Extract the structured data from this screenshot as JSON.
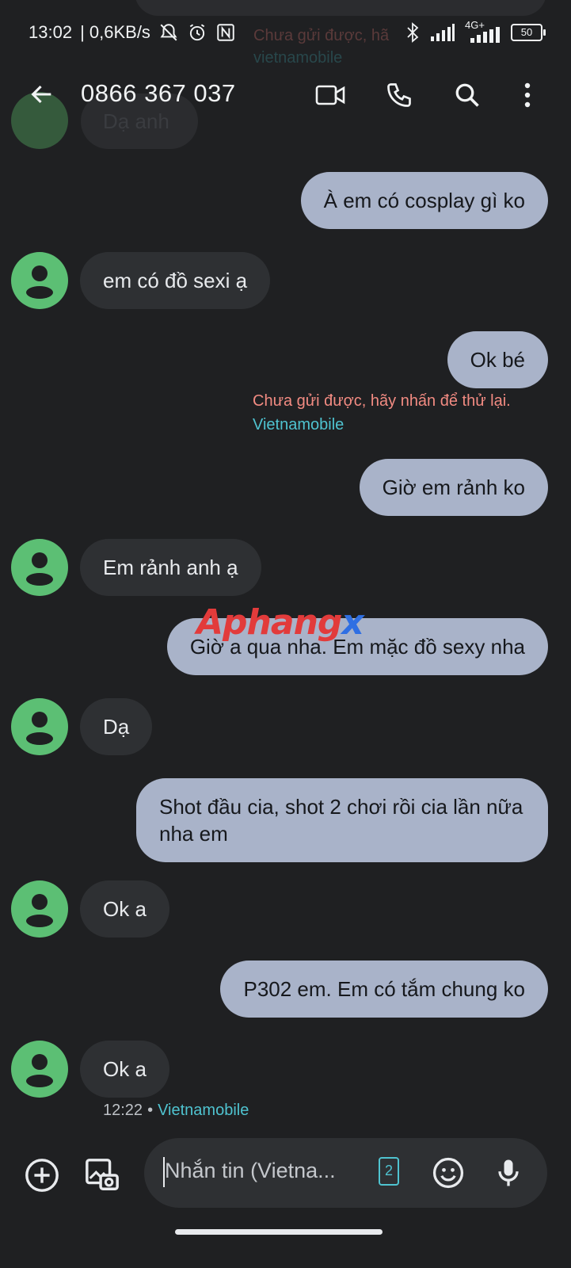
{
  "status_bar": {
    "time": "13:02",
    "speed": "| 0,6KB/s",
    "network_label": "4G+",
    "battery": "50",
    "icons": [
      "mute-bell-icon",
      "alarm-icon",
      "nfc-icon",
      "bluetooth-icon",
      "signal-icon",
      "signal-4g-icon",
      "battery-icon"
    ]
  },
  "app_bar": {
    "title": "0866 367 037",
    "actions": [
      "video-call-icon",
      "phone-icon",
      "search-icon",
      "more-vert-icon"
    ]
  },
  "ghost": {
    "top_error": "Chưa gửi được, hã",
    "top_carrier": "vietnamobile",
    "partial_incoming": "Dạ anh"
  },
  "messages": [
    {
      "dir": "out",
      "text": "À em có cosplay gì ko"
    },
    {
      "dir": "in",
      "text": "em có đồ sexi ạ"
    },
    {
      "dir": "out",
      "text": "Ok bé",
      "error": "Chưa gửi được, hãy nhấn để thử lại.",
      "carrier": "Vietnamobile"
    },
    {
      "dir": "out",
      "text": "Giờ em rảnh ko"
    },
    {
      "dir": "in",
      "text": "Em rảnh anh ạ"
    },
    {
      "dir": "out",
      "text": "Giờ a qua nha. Em mặc đồ sexy nha"
    },
    {
      "dir": "in",
      "text": "Dạ"
    },
    {
      "dir": "out",
      "text": "Shot đầu cia, shot 2 chơi rồi cia lần nữa nha em"
    },
    {
      "dir": "in",
      "text": "Ok a"
    },
    {
      "dir": "out",
      "text": "P302 em. Em có tắm chung ko"
    },
    {
      "dir": "in",
      "text": "Ok a",
      "time": "12:22",
      "carrier": "Vietnamobile"
    }
  ],
  "watermark": {
    "part1": "Aphang",
    "part2": "x"
  },
  "composer": {
    "placeholder": "Nhắn tin (Vietna...",
    "sim_label": "2",
    "icons": [
      "add-circle-icon",
      "gallery-icon",
      "sim-icon",
      "emoji-icon",
      "mic-icon"
    ]
  },
  "colors": {
    "background": "#1f2022",
    "incoming_bubble": "#2e3033",
    "outgoing_bubble": "#a9b3c9",
    "avatar": "#5cbf74",
    "error": "#f28b82",
    "carrier": "#4fc3d0"
  }
}
